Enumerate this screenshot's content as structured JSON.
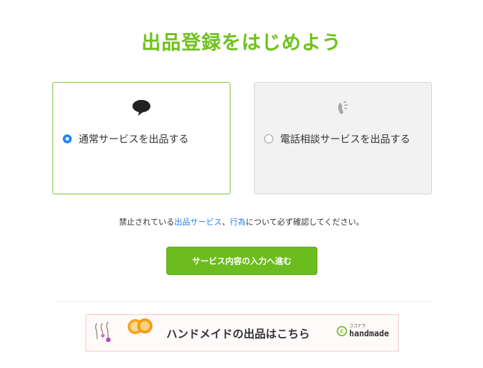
{
  "page": {
    "title": "出品登録をはじめよう"
  },
  "service_options": [
    {
      "label": "通常サービスを出品する",
      "selected": true,
      "icon": "speech-bubble-icon"
    },
    {
      "label": "電話相談サービスを出品する",
      "selected": false,
      "icon": "phone-icon"
    }
  ],
  "notice": {
    "prefix": "禁止されている",
    "link_services": "出品サービス",
    "separator": "、",
    "link_acts": "行為",
    "suffix": "について必ず確認してください。"
  },
  "cta": {
    "label": "サービス内容の入力へ進む"
  },
  "handmade_banner": {
    "text": "ハンドメイドの出品はこちら",
    "logo_mark": "c",
    "logo_kana": "ココナラ",
    "logo_text": "handmade"
  },
  "colors": {
    "brand_green": "#6ec21b",
    "link_blue": "#2a86e8",
    "radio_blue": "#2a86e8",
    "banner_border": "#f3c7c7"
  }
}
